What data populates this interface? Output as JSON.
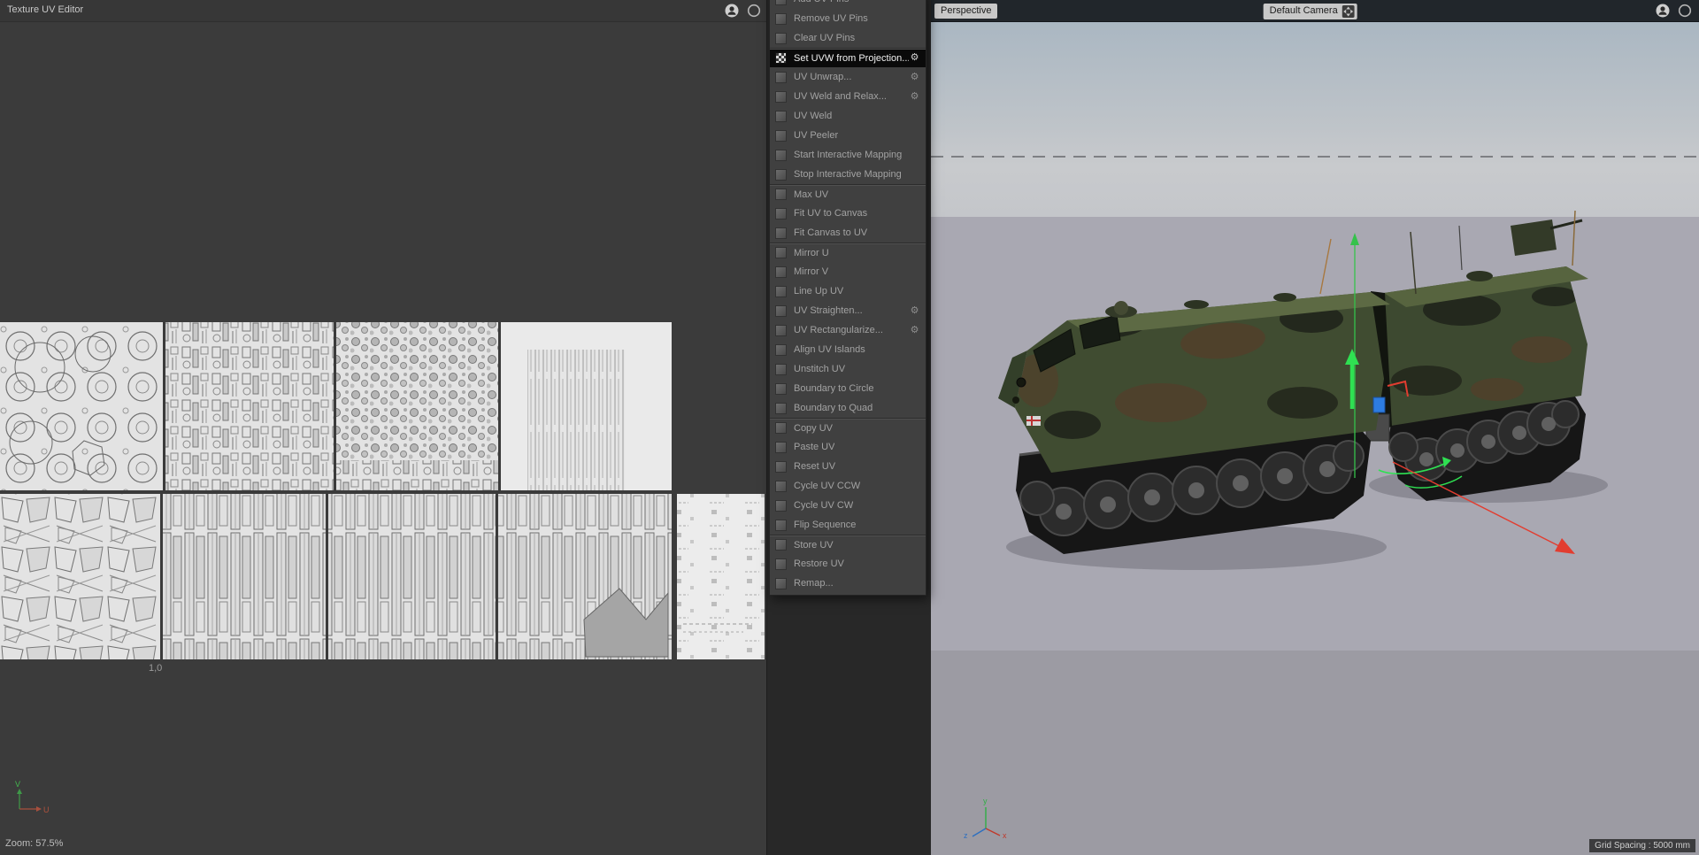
{
  "uv_panel": {
    "title": "Texture UV Editor",
    "zoom_label": "Zoom: 57.5%",
    "coord_label": "1,0",
    "axis_v": "V",
    "axis_u": "U"
  },
  "menu": {
    "items": [
      {
        "label": "Add UV Pins",
        "clipped": true
      },
      {
        "label": "Remove UV Pins"
      },
      {
        "label": "Clear UV Pins"
      },
      {
        "label": "Set UVW from Projection...",
        "highlighted": true,
        "gear": true,
        "group_start": true
      },
      {
        "label": "UV Unwrap...",
        "gear": true
      },
      {
        "label": "UV Weld and Relax...",
        "gear": true
      },
      {
        "label": "UV Weld"
      },
      {
        "label": "UV Peeler"
      },
      {
        "label": "Start Interactive Mapping"
      },
      {
        "label": "Stop Interactive Mapping"
      },
      {
        "label": "Max UV",
        "group_start": true
      },
      {
        "label": "Fit UV to Canvas"
      },
      {
        "label": "Fit Canvas to UV"
      },
      {
        "label": "Mirror U",
        "group_start": true
      },
      {
        "label": "Mirror V"
      },
      {
        "label": "Line Up UV"
      },
      {
        "label": "UV Straighten...",
        "gear": true
      },
      {
        "label": "UV Rectangularize...",
        "gear": true
      },
      {
        "label": "Align UV Islands"
      },
      {
        "label": "Unstitch UV"
      },
      {
        "label": "Boundary to Circle"
      },
      {
        "label": "Boundary to Quad"
      },
      {
        "label": "Copy UV",
        "group_start": true
      },
      {
        "label": "Paste UV"
      },
      {
        "label": "Reset UV"
      },
      {
        "label": "Cycle UV CCW"
      },
      {
        "label": "Cycle UV CW"
      },
      {
        "label": "Flip Sequence"
      },
      {
        "label": "Store UV",
        "group_start": true
      },
      {
        "label": "Restore UV"
      },
      {
        "label": "Remap..."
      }
    ]
  },
  "viewport": {
    "view_mode": "Perspective",
    "camera": "Default Camera",
    "grid_spacing": "Grid Spacing : 5000 mm",
    "axis_x": "x",
    "axis_y": "y",
    "axis_z": "z"
  },
  "colors": {
    "gizmo_green": "#2fe052",
    "gizmo_red": "#e23d30",
    "accent_blue": "#2d7ce0"
  }
}
